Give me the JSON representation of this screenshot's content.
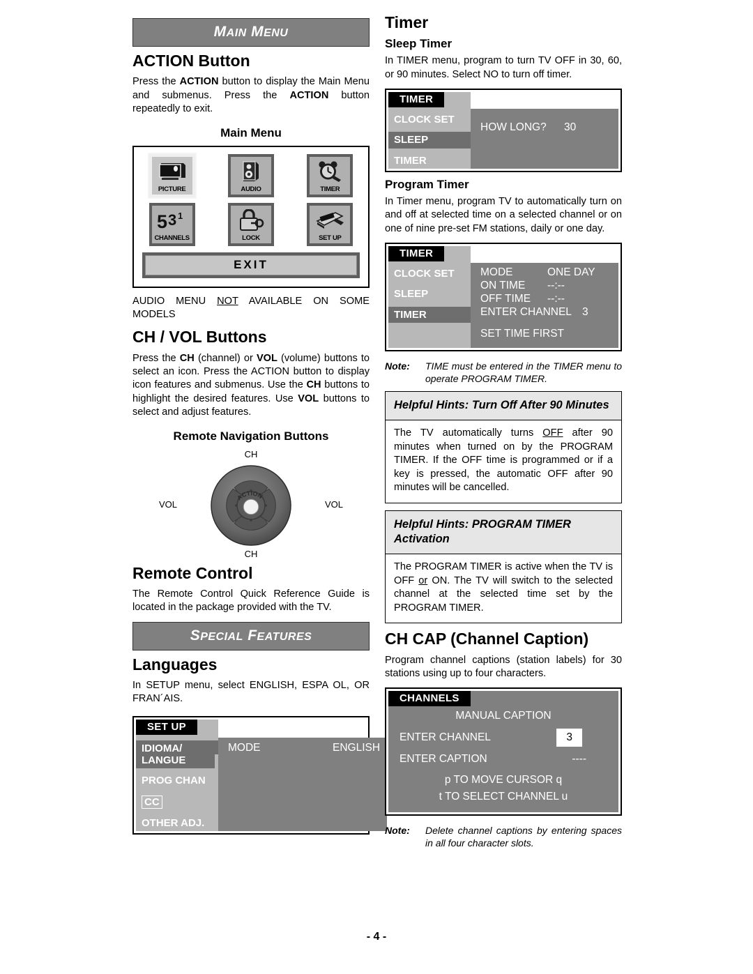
{
  "page": {
    "number_label": "- 4 -"
  },
  "left_column": {
    "banner_main_menu": "Main Menu",
    "action_button": {
      "heading": "ACTION Button",
      "paragraph_parts": [
        {
          "t": "Press the ",
          "b": false
        },
        {
          "t": "ACTION",
          "b": true
        },
        {
          "t": " button to display the Main Menu and submenus.  Press the ",
          "b": false
        },
        {
          "t": "ACTION",
          "b": true
        },
        {
          "t": " button repeatedly to exit.",
          "b": false
        }
      ],
      "paragraph_plain": "Press the ACTION button to display the Main Menu and submenus.  Press the ACTION button repeatedly to exit."
    },
    "main_menu_figure": {
      "caption": "Main Menu",
      "tiles": [
        {
          "label": "PICTURE",
          "icon": "tv-picture-icon",
          "highlighted": true
        },
        {
          "label": "AUDIO",
          "icon": "speaker-audio-icon",
          "highlighted": false
        },
        {
          "label": "TIMER",
          "icon": "alarm-clock-icon",
          "highlighted": false
        },
        {
          "label": "CHANNELS",
          "icon": "channel-numbers-icon",
          "highlighted": false
        },
        {
          "label": "LOCK",
          "icon": "padlock-icon",
          "highlighted": false
        },
        {
          "label": "SET UP",
          "icon": "setup-tools-icon",
          "highlighted": false
        }
      ],
      "exit_label": "EXIT"
    },
    "audio_note_plain": "AUDIO MENU NOT AVAILABLE ON SOME MODELS",
    "audio_note_parts": [
      {
        "t": "AUDIO  MENU  ",
        "u": false
      },
      {
        "t": "NOT",
        "u": true
      },
      {
        "t": "  AVAILABLE  ON  SOME MODELS",
        "u": false
      }
    ],
    "ch_vol": {
      "heading": "CH / VOL Buttons",
      "paragraph_parts": [
        {
          "t": "Press the ",
          "b": false
        },
        {
          "t": "CH",
          "b": true
        },
        {
          "t": " (channel) or ",
          "b": false
        },
        {
          "t": "VOL",
          "b": true
        },
        {
          "t": " (volume) buttons to select an icon.  Press the ACTION button to display icon features and submenus. Use the ",
          "b": false
        },
        {
          "t": "CH",
          "b": true
        },
        {
          "t": " buttons to highlight the desired features. Use ",
          "b": false
        },
        {
          "t": "VOL",
          "b": true
        },
        {
          "t": " buttons to select and adjust features.",
          "b": false
        }
      ],
      "paragraph_plain": "Press the CH (channel) or VOL (volume) buttons to select an icon.  Press the ACTION button to display icon features and submenus. Use the CH buttons to highlight the desired features. Use VOL buttons to select and adjust features."
    },
    "remote_nav": {
      "caption": "Remote Navigation Buttons",
      "label_top": "CH",
      "label_bottom": "CH",
      "label_left": "VOL",
      "label_right": "VOL",
      "center_label": "ACTION"
    },
    "remote_control": {
      "heading": "Remote Control",
      "paragraph": "The Remote Control Quick Reference Guide is located in the package provided with the TV."
    },
    "banner_special_features": "Special Features",
    "languages": {
      "heading": "Languages",
      "paragraph": "In SETUP menu, select ENGLISH, ESPA OL, OR FRAN´AIS."
    },
    "setup_osd": {
      "title": "SET UP",
      "items": [
        {
          "label": "IDIOMA/",
          "selected": true,
          "boxed": false
        },
        {
          "label": "LANGUE",
          "selected": true,
          "boxed": false
        },
        {
          "label": "PROG CHAN",
          "selected": false,
          "boxed": false
        },
        {
          "label": "CC",
          "selected": false,
          "boxed": true
        },
        {
          "label": "OTHER ADJ.",
          "selected": false,
          "boxed": false
        }
      ],
      "right_rows": [
        {
          "label": "MODE",
          "value": "ENGLISH"
        }
      ]
    }
  },
  "right_column": {
    "timer": {
      "heading": "Timer",
      "sleep_timer": {
        "subheading": "Sleep Timer",
        "paragraph": "In TIMER menu, program to turn TV OFF in 30, 60, or 90 minutes.  Select NO to turn off timer."
      },
      "sleep_osd": {
        "title": "TIMER",
        "items": [
          {
            "label": "CLOCK SET",
            "selected": false
          },
          {
            "label": "SLEEP",
            "selected": true
          },
          {
            "label": "TIMER",
            "selected": false
          }
        ],
        "marker": "u",
        "right_rows": [
          {
            "label": "HOW LONG?",
            "value": "30"
          }
        ]
      },
      "program_timer": {
        "subheading": "Program Timer",
        "paragraph": "In Timer menu, program TV to automatically turn on and off at selected time on a selected channel or on one of nine pre-set FM stations, daily or one day."
      },
      "program_osd": {
        "title": "TIMER",
        "items": [
          {
            "label": "CLOCK SET",
            "selected": false
          },
          {
            "label": "SLEEP",
            "selected": false
          },
          {
            "label": "TIMER",
            "selected": true
          }
        ],
        "marker": "u",
        "right_rows": [
          {
            "label": "MODE",
            "value": "ONE DAY"
          },
          {
            "label": "ON TIME",
            "value": "--:--"
          },
          {
            "label": "OFF TIME",
            "value": "--:--"
          },
          {
            "label": "ENTER CHANNEL",
            "value": "3"
          }
        ],
        "footer": "SET TIME FIRST"
      },
      "note": {
        "label": "Note:",
        "text": "TIME must be entered in the TIMER menu to operate PROGRAM TIMER."
      }
    },
    "hint_90min": {
      "title": "Helpful Hints:  Turn Off After 90 Minutes",
      "body_plain": "The TV automatically turns OFF after 90 minutes when turned on by the PROGRAM TIMER.  If the OFF time is programmed or if a key is pressed, the automatic OFF after 90 minutes will be cancelled.",
      "body_parts": [
        {
          "t": "The  TV  automatically  turns  ",
          "u": false
        },
        {
          "t": "OFF",
          "u": true
        },
        {
          "t": "  after  90 minutes  when  turned  on  by  the  PROGRAM TIMER.  If the OFF time is programmed or if a key  is  pressed,  the  automatic  OFF  after  90 minutes will be cancelled.",
          "u": false
        }
      ]
    },
    "hint_activation": {
      "title": "Helpful Hints:  PROGRAM TIMER Activation",
      "body_plain": "The PROGRAM TIMER is active when the TV is OFF or ON.  The TV will switch to the selected channel at the selected time set by the PROGRAM TIMER.",
      "body_parts": [
        {
          "t": "The PROGRAM TIMER is active when the TV is OFF ",
          "u": false
        },
        {
          "t": "or",
          "u": true
        },
        {
          "t": " ON.  The TV will switch to the selected channel  at  the  selected  time  set  by  the PROGRAM TIMER.",
          "u": false
        }
      ]
    },
    "ch_cap": {
      "heading": "CH CAP (Channel Caption)",
      "paragraph": "Program channel captions (station labels) for 30 stations using up to four characters."
    },
    "channels_osd": {
      "title": "CHANNELS",
      "header": "MANUAL CAPTION",
      "rows": [
        {
          "label": "ENTER CHANNEL",
          "value": "3",
          "boxed": true
        },
        {
          "label": "ENTER CAPTION",
          "value": "----",
          "boxed": false
        }
      ],
      "hint_cursor": "p   TO MOVE CURSOR  q",
      "hint_channel": "t   TO SELECT CHANNEL  u"
    },
    "note": {
      "label": "Note:",
      "text": "Delete  channel  captions  by  entering spaces  in all four character slots."
    }
  },
  "colors": {
    "banner_bg": "#808080",
    "osd_menu_left_bg": "#b8b8b8",
    "osd_menu_right_bg": "#808080",
    "osd_title_bg": "#000000",
    "osd_selected_bg": "#6e6e6e",
    "hint_title_bg": "#e6e6e6",
    "text": "#000000"
  }
}
